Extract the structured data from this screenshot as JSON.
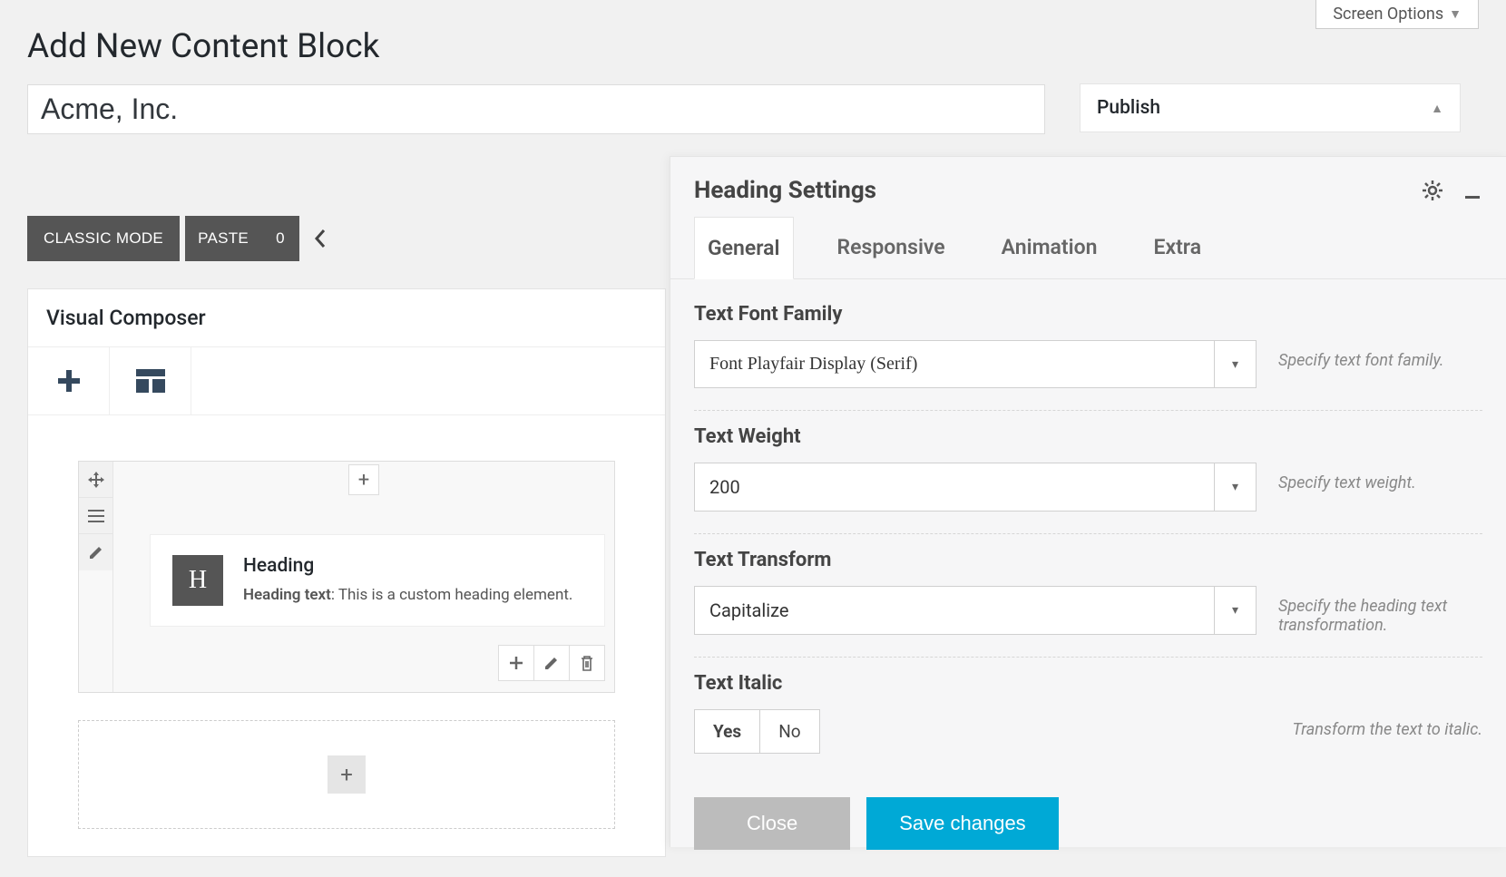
{
  "screen_options_label": "Screen Options",
  "page_title": "Add New Content Block",
  "title_value": "Acme, Inc.",
  "toolbar": {
    "classic_mode": "CLASSIC MODE",
    "paste": "PASTE",
    "paste_count": "0"
  },
  "visual_composer": {
    "title": "Visual Composer",
    "element": {
      "icon_letter": "H",
      "title": "Heading",
      "desc_label": "Heading text",
      "desc_value": ": This is a custom heading element."
    }
  },
  "publish": {
    "title": "Publish"
  },
  "settings": {
    "title": "Heading Settings",
    "tabs": {
      "general": "General",
      "responsive": "Responsive",
      "animation": "Animation",
      "extra": "Extra"
    },
    "fields": {
      "font_family": {
        "label": "Text Font Family",
        "value": "Font Playfair Display (Serif)",
        "help": "Specify text font family."
      },
      "weight": {
        "label": "Text Weight",
        "value": "200",
        "help": "Specify text weight."
      },
      "transform": {
        "label": "Text Transform",
        "value": "Capitalize",
        "help": "Specify the heading text transformation."
      },
      "italic": {
        "label": "Text Italic",
        "yes": "Yes",
        "no": "No",
        "help": "Transform the text to italic."
      }
    },
    "footer": {
      "close": "Close",
      "save": "Save changes"
    }
  }
}
